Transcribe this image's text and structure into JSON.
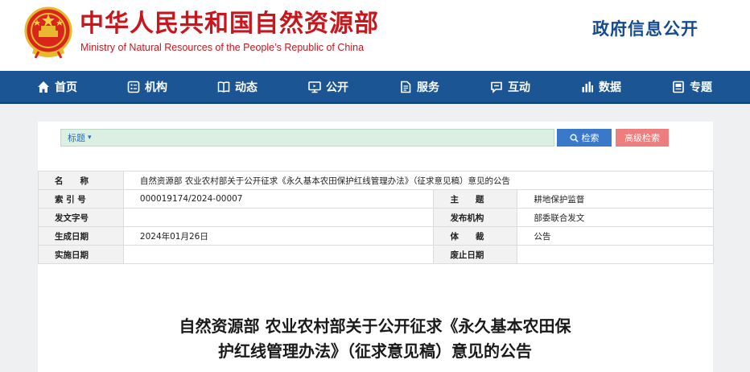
{
  "header": {
    "title_cn": "中华人民共和国自然资源部",
    "title_en": "Ministry of Natural Resources of the People’s Republic of China",
    "gov_info": "政府信息公开"
  },
  "nav": {
    "items": [
      {
        "label": "首页",
        "icon": "home-icon"
      },
      {
        "label": "机构",
        "icon": "organization-icon"
      },
      {
        "label": "动态",
        "icon": "book-icon"
      },
      {
        "label": "公开",
        "icon": "monitor-icon"
      },
      {
        "label": "服务",
        "icon": "document-icon"
      },
      {
        "label": "互动",
        "icon": "chat-icon"
      },
      {
        "label": "数据",
        "icon": "bar-chart-icon"
      },
      {
        "label": "专题",
        "icon": "topic-icon"
      }
    ]
  },
  "search": {
    "field_label": "标题",
    "search_label": "检索",
    "advanced_label": "高级检索"
  },
  "info": {
    "name_key": "名　　称",
    "name_value": "自然资源部 农业农村部关于公开征求《永久基本农田保护红线管理办法》（征求意见稿）意见的公告",
    "index_key": "索 引 号",
    "index_value": "000019174/2024-00007",
    "subject_key": "主　　题",
    "subject_value": "耕地保护监督",
    "docno_key": "发文字号",
    "docno_value": "",
    "issuer_key": "发布机构",
    "issuer_value": "部委联合发文",
    "date_key": "生成日期",
    "date_value": "2024年01月26日",
    "genre_key": "体　　裁",
    "genre_value": "公告",
    "effective_key": "实施日期",
    "effective_value": "",
    "expiry_key": "废止日期",
    "expiry_value": ""
  },
  "article": {
    "title_line1": "自然资源部 农业农村部关于公开征求《永久基本农田保",
    "title_line2": "护红线管理办法》（征求意见稿）意见的公告"
  },
  "colors": {
    "brand_red": "#c8161d",
    "nav_blue": "#1c5593",
    "search_blue": "#3a78c9",
    "advanced_pink": "#ee7e7d"
  }
}
